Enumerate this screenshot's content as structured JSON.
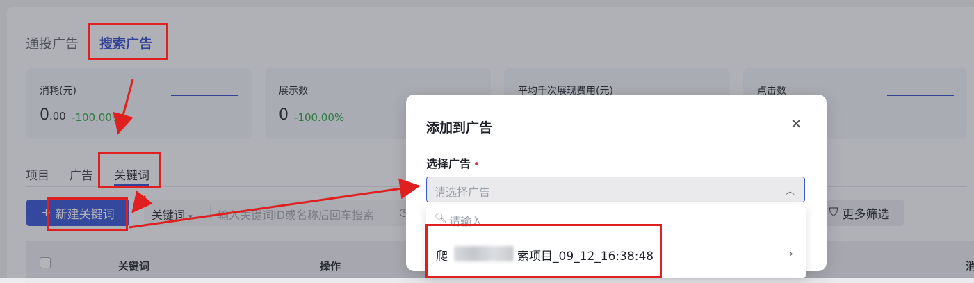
{
  "ad_type_tabs": [
    "通投广告",
    "搜索广告"
  ],
  "metrics": [
    {
      "label": "消耗(元)",
      "value_int": "0",
      "value_dec": ".00",
      "change": "-100.00%"
    },
    {
      "label": "展示数",
      "value_int": "0",
      "value_dec": "",
      "change": "-100.00%"
    },
    {
      "label": "平均千次展现费用(元)"
    },
    {
      "label": "点击数"
    }
  ],
  "sub_tabs": [
    "项目",
    "广告",
    "关键词"
  ],
  "toolbar": {
    "new_keyword_label": "新建关键词",
    "filter_field_label": "关键词",
    "search_placeholder": "输入关键词ID或名称后回车搜索",
    "more_filters_label": "更多筛选"
  },
  "table": {
    "columns": [
      "关键词",
      "操作"
    ],
    "right_partial": "消"
  },
  "modal": {
    "title": "添加到广告",
    "field_label": "选择广告",
    "select_placeholder": "请选择广告",
    "search_placeholder": "请输入",
    "option_prefix": "爬",
    "option_suffix": "索项目_09_12_16:38:48"
  },
  "colors": {
    "accent": "#2a48c9",
    "positive": "#23a33e",
    "annotation": "#e02020"
  }
}
